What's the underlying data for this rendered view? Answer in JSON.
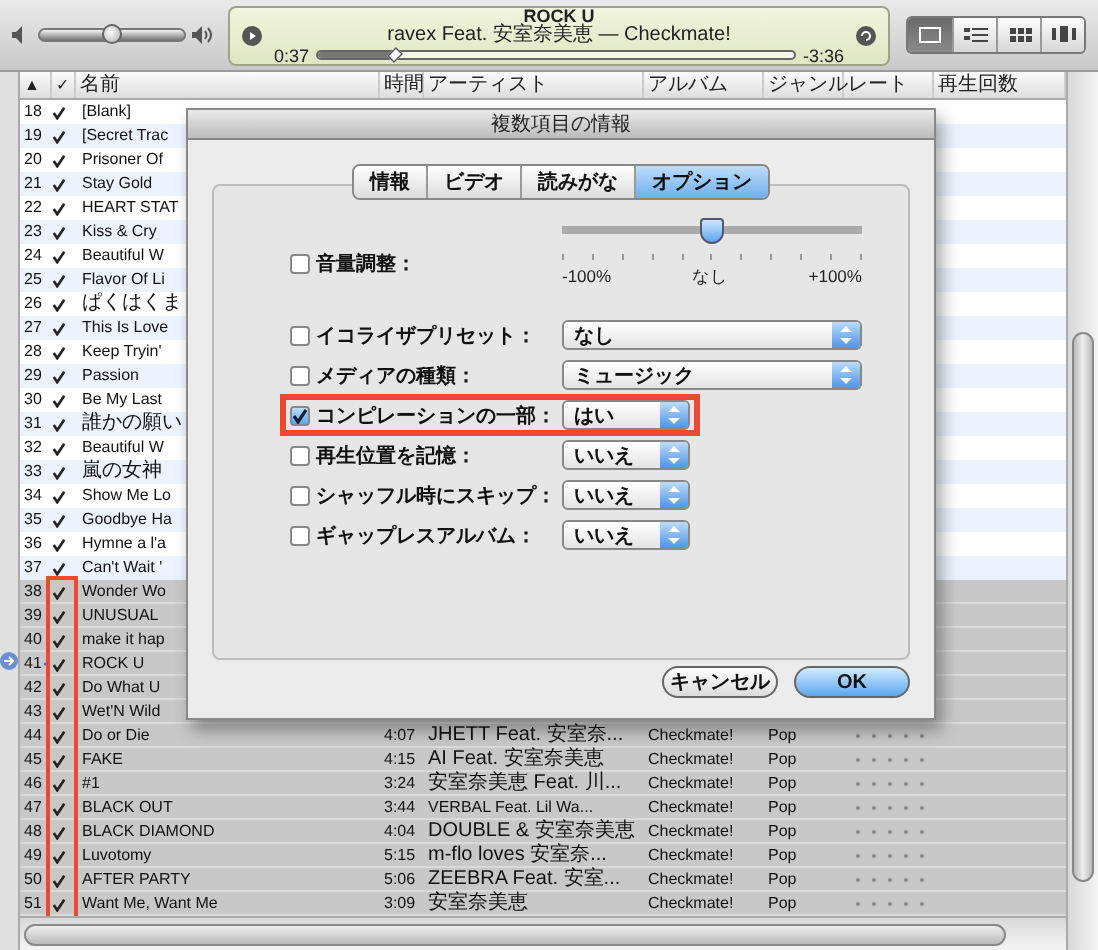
{
  "player": {
    "volume": {
      "level": 0.5
    },
    "title": "ROCK U",
    "subtitle": "ravex Feat. 安室奈美恵 — Checkmate!",
    "elapsed": "0:37",
    "remaining": "-3:36",
    "progress": {
      "level": 0.16
    }
  },
  "view_buttons": [
    {
      "kind": "list",
      "selected": true
    },
    {
      "kind": "album",
      "selected": false
    },
    {
      "kind": "grid",
      "selected": false
    },
    {
      "kind": "coverflow",
      "selected": false
    }
  ],
  "table": {
    "columns": [
      {
        "label": "▲"
      },
      {
        "label": "✓"
      },
      {
        "label": "名前"
      },
      {
        "label": "時間"
      },
      {
        "label": "アーティスト"
      },
      {
        "label": "アルバム"
      },
      {
        "label": "ジャンル"
      },
      {
        "label": "レート"
      },
      {
        "label": "再生回数"
      }
    ],
    "rows": [
      {
        "number": "18",
        "checked": true,
        "name": "[Blank]",
        "selected": false,
        "playing": false,
        "annotated": false
      },
      {
        "number": "19",
        "checked": true,
        "name": "[Secret Trac",
        "selected": false,
        "playing": false,
        "annotated": false
      },
      {
        "number": "20",
        "checked": true,
        "name": "Prisoner Of",
        "selected": false,
        "playing": false,
        "annotated": false
      },
      {
        "number": "21",
        "checked": true,
        "name": "Stay Gold",
        "selected": false,
        "playing": false,
        "annotated": false
      },
      {
        "number": "22",
        "checked": true,
        "name": "HEART STAT",
        "selected": false,
        "playing": false,
        "annotated": false
      },
      {
        "number": "23",
        "checked": true,
        "name": "Kiss & Cry",
        "selected": false,
        "playing": false,
        "annotated": false
      },
      {
        "number": "24",
        "checked": true,
        "name": "Beautiful W",
        "selected": false,
        "playing": false,
        "annotated": false
      },
      {
        "number": "25",
        "checked": true,
        "name": "Flavor Of Li",
        "selected": false,
        "playing": false,
        "annotated": false
      },
      {
        "number": "26",
        "checked": true,
        "name": "ぱくはくま",
        "selected": false,
        "playing": false,
        "annotated": false
      },
      {
        "number": "27",
        "checked": true,
        "name": "This Is Love",
        "selected": false,
        "playing": false,
        "annotated": false
      },
      {
        "number": "28",
        "checked": true,
        "name": "Keep Tryin'",
        "selected": false,
        "playing": false,
        "annotated": false
      },
      {
        "number": "29",
        "checked": true,
        "name": "Passion",
        "selected": false,
        "playing": false,
        "annotated": false
      },
      {
        "number": "30",
        "checked": true,
        "name": "Be My Last",
        "selected": false,
        "playing": false,
        "annotated": false
      },
      {
        "number": "31",
        "checked": true,
        "name": "誰かの願い",
        "selected": false,
        "playing": false,
        "annotated": false
      },
      {
        "number": "32",
        "checked": true,
        "name": "Beautiful W",
        "selected": false,
        "playing": false,
        "annotated": false
      },
      {
        "number": "33",
        "checked": true,
        "name": "嵐の女神",
        "selected": false,
        "playing": false,
        "annotated": false
      },
      {
        "number": "34",
        "checked": true,
        "name": "Show Me Lo",
        "selected": false,
        "playing": false,
        "annotated": false
      },
      {
        "number": "35",
        "checked": true,
        "name": "Goodbye Ha",
        "selected": false,
        "playing": false,
        "annotated": false
      },
      {
        "number": "36",
        "checked": true,
        "name": "Hymne a l'a",
        "selected": false,
        "playing": false,
        "annotated": false
      },
      {
        "number": "37",
        "checked": true,
        "name": "Can't Wait '",
        "selected": false,
        "playing": false,
        "annotated": false
      },
      {
        "number": "38",
        "checked": true,
        "name": "Wonder Wo",
        "selected": true,
        "playing": false,
        "annotated": true
      },
      {
        "number": "39",
        "checked": true,
        "name": "UNUSUAL",
        "selected": true,
        "playing": false,
        "annotated": true
      },
      {
        "number": "40",
        "checked": true,
        "name": "make it hap",
        "selected": true,
        "playing": false,
        "annotated": true
      },
      {
        "number": "41",
        "checked": true,
        "name": "ROCK U",
        "selected": true,
        "playing": true,
        "annotated": true
      },
      {
        "number": "42",
        "checked": true,
        "name": "Do What U",
        "selected": true,
        "playing": false,
        "annotated": true
      },
      {
        "number": "43",
        "checked": true,
        "name": "Wet'N Wild",
        "selected": true,
        "playing": false,
        "annotated": true
      },
      {
        "number": "44",
        "checked": true,
        "name": "Do or Die",
        "time": "4:07",
        "artist": "JHETT Feat. 安室奈...",
        "album": "Checkmate!",
        "genre": "Pop",
        "stars": 0,
        "selected": true,
        "playing": false,
        "annotated": true
      },
      {
        "number": "45",
        "checked": true,
        "name": "FAKE",
        "time": "4:15",
        "artist": "AI Feat. 安室奈美恵",
        "album": "Checkmate!",
        "genre": "Pop",
        "stars": 0,
        "selected": true,
        "playing": false,
        "annotated": true
      },
      {
        "number": "46",
        "checked": true,
        "name": "#1",
        "time": "3:24",
        "artist": "安室奈美恵 Feat. 川...",
        "album": "Checkmate!",
        "genre": "Pop",
        "stars": 0,
        "selected": true,
        "playing": false,
        "annotated": true
      },
      {
        "number": "47",
        "checked": true,
        "name": "BLACK OUT",
        "time": "3:44",
        "artist": "VERBAL Feat. Lil Wa...",
        "album": "Checkmate!",
        "genre": "Pop",
        "stars": 0,
        "selected": true,
        "playing": false,
        "annotated": true
      },
      {
        "number": "48",
        "checked": true,
        "name": "BLACK DIAMOND",
        "time": "4:04",
        "artist": "DOUBLE & 安室奈美恵",
        "album": "Checkmate!",
        "genre": "Pop",
        "stars": 0,
        "selected": true,
        "playing": false,
        "annotated": true
      },
      {
        "number": "49",
        "checked": true,
        "name": "Luvotomy",
        "time": "5:15",
        "artist": "m-flo loves 安室奈...",
        "album": "Checkmate!",
        "genre": "Pop",
        "stars": 0,
        "selected": true,
        "playing": false,
        "annotated": true
      },
      {
        "number": "50",
        "checked": true,
        "name": "AFTER PARTY",
        "time": "5:06",
        "artist": "ZEEBRA Feat. 安室...",
        "album": "Checkmate!",
        "genre": "Pop",
        "stars": 0,
        "selected": true,
        "playing": false,
        "annotated": true
      },
      {
        "number": "51",
        "checked": true,
        "name": "Want Me, Want Me",
        "time": "3:09",
        "artist": "安室奈美恵",
        "album": "Checkmate!",
        "genre": "Pop",
        "stars": 0,
        "selected": true,
        "playing": false,
        "annotated": true
      }
    ]
  },
  "dialog": {
    "title": "複数項目の情報",
    "tabs": [
      {
        "label": "情報",
        "selected": false
      },
      {
        "label": "ビデオ",
        "selected": false
      },
      {
        "label": "読みがな",
        "selected": false
      },
      {
        "label": "オプション",
        "selected": true
      }
    ],
    "options": [
      {
        "kind": "slider",
        "label": "音量調整：",
        "checked": false,
        "highlighted": false,
        "level": 0.5,
        "min_label": "-100%",
        "mid_label": "なし",
        "max_label": "+100%"
      },
      {
        "kind": "popup",
        "label": "イコライザプリセット：",
        "checked": false,
        "highlighted": false,
        "value": "なし"
      },
      {
        "kind": "popup",
        "label": "メディアの種類：",
        "checked": false,
        "highlighted": false,
        "value": "ミュージック"
      },
      {
        "kind": "choice",
        "label": "コンピレーションの一部：",
        "checked": true,
        "highlighted": true,
        "value": "はい"
      },
      {
        "kind": "choice",
        "label": "再生位置を記憶：",
        "checked": false,
        "highlighted": false,
        "value": "いいえ"
      },
      {
        "kind": "choice",
        "label": "シャッフル時にスキップ：",
        "checked": false,
        "highlighted": false,
        "value": "いいえ"
      },
      {
        "kind": "choice",
        "label": "ギャップレスアルバム：",
        "checked": false,
        "highlighted": false,
        "value": "いいえ"
      }
    ],
    "buttons": [
      {
        "label": "キャンセル",
        "kind": "secondary"
      },
      {
        "label": "OK",
        "kind": "primary"
      }
    ]
  }
}
